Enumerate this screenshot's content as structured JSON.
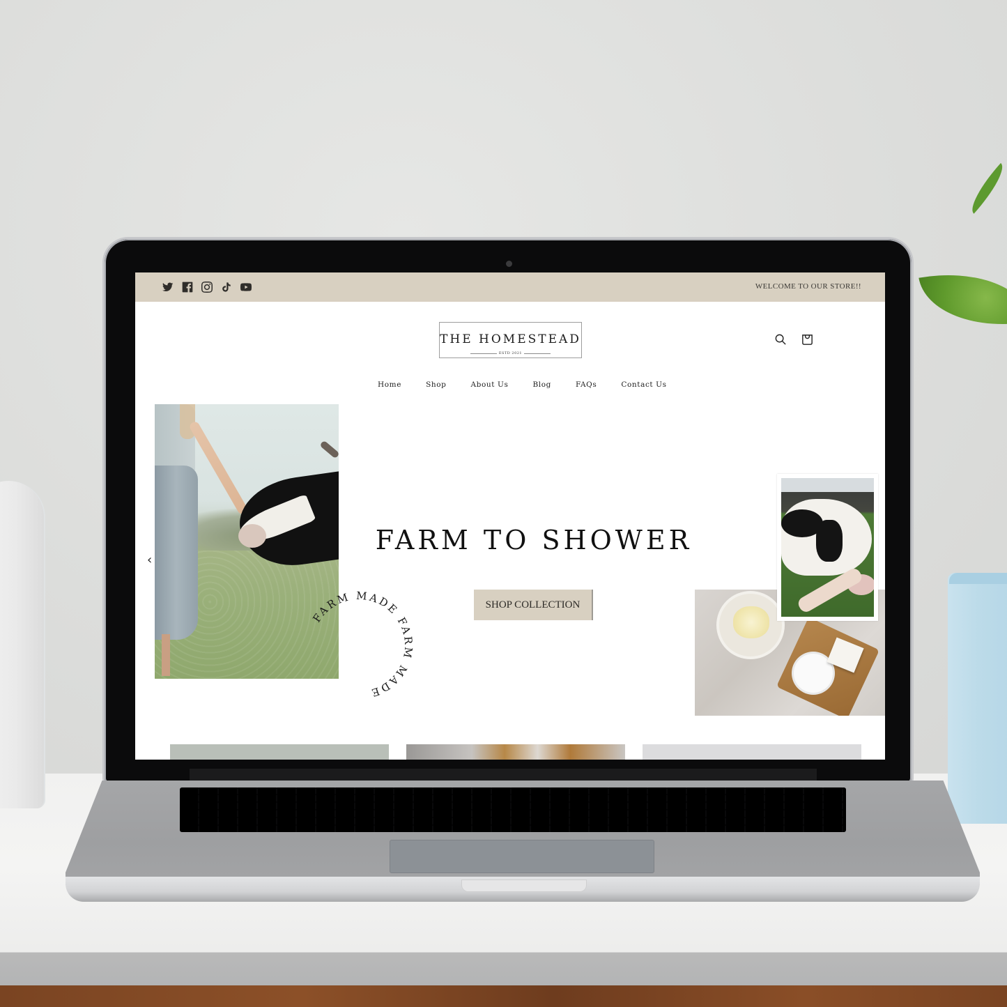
{
  "scene": {
    "description": "Laptop on white desk displaying an online store homepage"
  },
  "announcement_bar": {
    "social_icons": [
      {
        "name": "twitter-icon",
        "label": "Twitter"
      },
      {
        "name": "facebook-icon",
        "label": "Facebook"
      },
      {
        "name": "instagram-icon",
        "label": "Instagram"
      },
      {
        "name": "tiktok-icon",
        "label": "TikTok"
      },
      {
        "name": "youtube-icon",
        "label": "YouTube"
      }
    ],
    "message": "WELCOME TO OUR STORE!!"
  },
  "header": {
    "logo_title": "THE HOMESTEAD",
    "logo_estd": "ESTD 2021",
    "search_icon": "search-icon",
    "cart_icon": "cart-icon"
  },
  "nav": {
    "items": [
      {
        "label": "Home"
      },
      {
        "label": "Shop"
      },
      {
        "label": "About Us"
      },
      {
        "label": "Blog"
      },
      {
        "label": "FAQs"
      },
      {
        "label": "Contact Us"
      }
    ]
  },
  "hero": {
    "title": "FARM TO SHOWER",
    "cta_label": "SHOP COLLECTION",
    "badge_text": "FARM MADE FARM MADE ",
    "prev_arrow": "‹",
    "next_arrow": "›"
  },
  "colors": {
    "announcement_bg": "#d8d0c1",
    "button_bg": "#d8d0c1",
    "text_dark": "#111111",
    "page_bg": "#ffffff"
  }
}
